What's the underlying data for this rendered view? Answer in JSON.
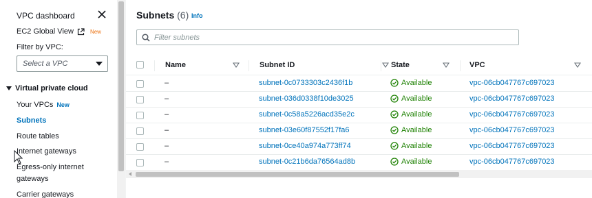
{
  "sidebar": {
    "dashboard_label": "VPC dashboard",
    "ec2_global_view": "EC2 Global View",
    "ec2_new_badge": "New",
    "filter_label": "Filter by VPC:",
    "filter_select": "Select a VPC",
    "section_title": "Virtual private cloud",
    "items": [
      {
        "label": "Your VPCs",
        "badge": "New"
      },
      {
        "label": "Subnets"
      },
      {
        "label": "Route tables"
      },
      {
        "label": "Internet gateways"
      },
      {
        "label": "Egress-only internet gateways"
      },
      {
        "label": "Carrier gateways"
      }
    ]
  },
  "main": {
    "title": "Subnets",
    "count": "(6)",
    "info_link": "Info",
    "search_placeholder": "Filter subnets",
    "columns": [
      "Name",
      "Subnet ID",
      "State",
      "VPC"
    ],
    "rows": [
      {
        "name": "–",
        "subnet_id": "subnet-0c0733303c2436f1b",
        "state": "Available",
        "vpc": "vpc-06cb047767c697023"
      },
      {
        "name": "–",
        "subnet_id": "subnet-036d0338f10de3025",
        "state": "Available",
        "vpc": "vpc-06cb047767c697023"
      },
      {
        "name": "–",
        "subnet_id": "subnet-0c58a5226acd35e2c",
        "state": "Available",
        "vpc": "vpc-06cb047767c697023"
      },
      {
        "name": "–",
        "subnet_id": "subnet-03e60f87552f17fa6",
        "state": "Available",
        "vpc": "vpc-06cb047767c697023"
      },
      {
        "name": "–",
        "subnet_id": "subnet-0ce40a974a773ff74",
        "state": "Available",
        "vpc": "vpc-06cb047767c697023"
      },
      {
        "name": "–",
        "subnet_id": "subnet-0c21b6da76564ad8b",
        "state": "Available",
        "vpc": "vpc-06cb047767c697023"
      }
    ]
  },
  "colors": {
    "link": "#0073bb",
    "available": "#1d8102",
    "new_orange": "#ec7211"
  }
}
